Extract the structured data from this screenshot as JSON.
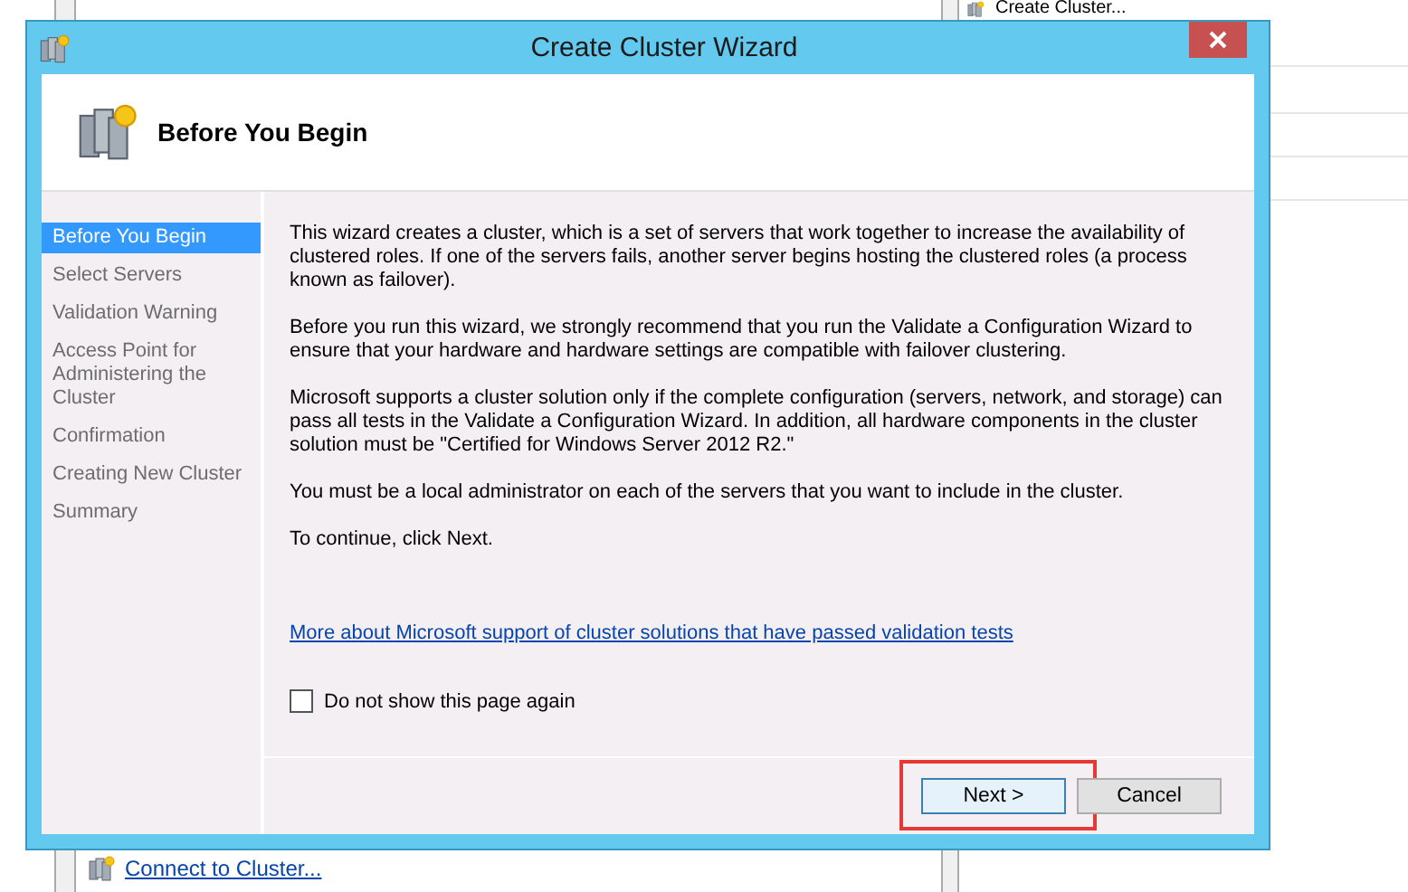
{
  "background": {
    "action_link": "Create Cluster...",
    "bottom_link": "Connect to Cluster..."
  },
  "window": {
    "title": "Create Cluster Wizard",
    "header": "Before You Begin"
  },
  "steps": [
    {
      "label": "Before You Begin",
      "selected": true
    },
    {
      "label": "Select Servers",
      "selected": false
    },
    {
      "label": "Validation Warning",
      "selected": false
    },
    {
      "label": "Access Point for Administering the Cluster",
      "selected": false
    },
    {
      "label": "Confirmation",
      "selected": false
    },
    {
      "label": "Creating New Cluster",
      "selected": false
    },
    {
      "label": "Summary",
      "selected": false
    }
  ],
  "paragraphs": [
    "This wizard creates a cluster, which is a set of servers that work together to increase the availability of clustered roles. If one of the servers fails, another server begins hosting the clustered roles (a process known as failover).",
    "Before you run this wizard, we strongly recommend that you run the Validate a Configuration Wizard to ensure that your hardware and hardware settings are compatible with failover clustering.",
    "Microsoft supports a cluster solution only if the complete configuration (servers, network, and storage) can pass all tests in the Validate a Configuration Wizard. In addition, all hardware components in the cluster solution must be \"Certified for Windows Server 2012 R2.\"",
    "You must be a local administrator on each of the servers that you want to include in the cluster.",
    "To continue, click Next."
  ],
  "link": "More about Microsoft support of cluster solutions that have passed validation tests",
  "dont_show_again": {
    "label": "Do not show this page again",
    "checked": false
  },
  "buttons": [
    {
      "label": "Next >",
      "highlighted": true
    },
    {
      "label": "Cancel",
      "highlighted": false
    }
  ]
}
